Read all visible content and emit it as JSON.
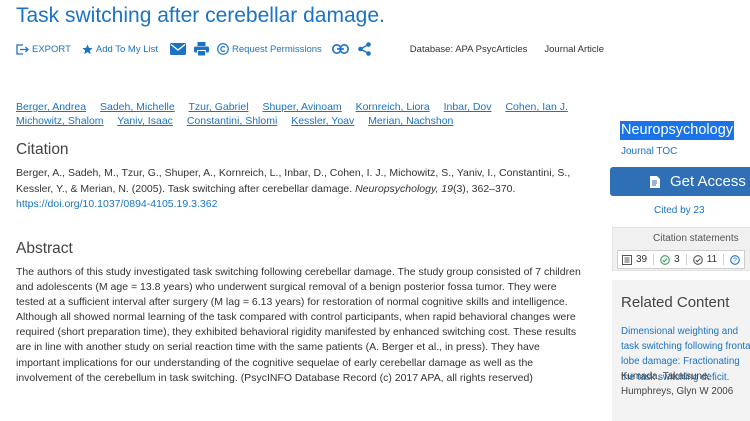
{
  "article": {
    "title": "Task switching after cerebellar damage."
  },
  "toolbar": {
    "export": "EXPORT",
    "add_to_list": "Add To My List",
    "request_permissions": "Request Permissions",
    "database": "Database: APA PsycArticles",
    "article_type": "Journal Article"
  },
  "authors": [
    "Berger, Andrea",
    "Sadeh, Michelle",
    "Tzur, Gabriel",
    "Shuper, Avinoam",
    "Kornreich, Liora",
    "Inbar, Dov",
    "Cohen, Ian J.",
    "Michowitz, Shalom",
    "Yaniv, Isaac",
    "Constantini, Shlomi",
    "Kessler, Yoav",
    "Merian, Nachshon"
  ],
  "citation": {
    "heading": "Citation",
    "text_before": "Berger, A., Sadeh, M., Tzur, G., Shuper, A., Kornreich, L., Inbar, D., Cohen, I. J., Michowitz, S., Yaniv, I., Constantini, S., Kessler, Y., & Merian, N. (2005). Task switching after cerebellar damage. ",
    "journal": "Neuropsychology, 19",
    "text_after": "(3), 362–370. ",
    "doi": "https://doi.org/10.1037/0894-4105.19.3.362"
  },
  "abstract": {
    "heading": "Abstract",
    "text": "The authors of this study investigated task switching following cerebellar damage. The study group consisted of 7 children and adolescents (M age = 13.8 years) who underwent surgical removal of a benign posterior fossa tumor. They were tested at a sufficient interval after surgery (M lag = 6.13 years) for restoration of normal cognitive skills and intelligence. Although all showed normal learning of the task compared with control participants, when rapid behavioral changes were required (short preparation time), they exhibited behavioral rigidity manifested by enhanced switching cost. These results are in line with another study on serial reaction time with the same patients (A. Berger et al., in press). They have important implications for our understanding of the cognitive sequelae of early cerebellar damage as well as the involvement of the cerebellum in task switching. (PsycINFO Database Record (c) 2017 APA, all rights reserved)"
  },
  "sidebar": {
    "journal_name": "Neuropsychology",
    "journal_toc": "Journal TOC",
    "get_access": "Get Access",
    "cited_by": "Cited by 23",
    "citation_statements": {
      "header": "Citation statements",
      "total": "39",
      "supporting": "3",
      "mentioning": "11"
    },
    "related": {
      "heading": "Related Content",
      "link": "Dimensional weighting and task switching following frontal lobe damage: Fractionating the task switching deficit.",
      "meta": "Kumada, Takatsune; Humphreys, Glyn W 2006"
    }
  },
  "colors": {
    "link": "#1a73c5",
    "button": "#2f6fb6",
    "highlight": "#1a73e8"
  }
}
